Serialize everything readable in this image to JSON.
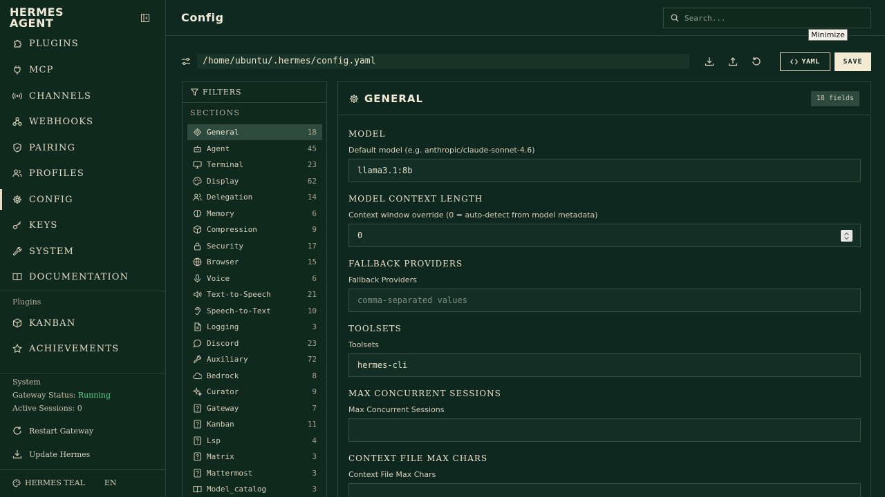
{
  "brand": {
    "line1": "HERMES",
    "line2": "AGENT"
  },
  "nav": [
    {
      "id": "plugins",
      "label": "PLUGINS",
      "icon": "puzzle-icon"
    },
    {
      "id": "mcp",
      "label": "MCP",
      "icon": "plug-icon"
    },
    {
      "id": "channels",
      "label": "CHANNELS",
      "icon": "broadcast-icon"
    },
    {
      "id": "webhooks",
      "label": "WEBHOOKS",
      "icon": "webhook-icon"
    },
    {
      "id": "pairing",
      "label": "PAIRING",
      "icon": "shield-icon"
    },
    {
      "id": "profiles",
      "label": "PROFILES",
      "icon": "users-icon"
    },
    {
      "id": "config",
      "label": "CONFIG",
      "icon": "gear-icon",
      "active": true
    },
    {
      "id": "keys",
      "label": "KEYS",
      "icon": "key-icon"
    },
    {
      "id": "system",
      "label": "SYSTEM",
      "icon": "wrench-icon"
    },
    {
      "id": "documentation",
      "label": "DOCUMENTATION",
      "icon": "book-icon"
    }
  ],
  "plugins_section": {
    "label": "Plugins",
    "items": [
      {
        "id": "kanban",
        "label": "KANBAN",
        "icon": "cube-icon"
      },
      {
        "id": "achievements",
        "label": "ACHIEVEMENTS",
        "icon": "star-icon"
      }
    ]
  },
  "system_status": {
    "label": "System",
    "gateway_label": "Gateway Status:",
    "gateway_value": "Running",
    "sessions_label": "Active Sessions:",
    "sessions_value": "0"
  },
  "actions": {
    "restart": "Restart Gateway",
    "update": "Update Hermes"
  },
  "footer": {
    "theme": "HERMES TEAL",
    "lang": "EN"
  },
  "header": {
    "title": "Config",
    "search_placeholder": "Search..."
  },
  "tooltip": "Minimize",
  "toolbar": {
    "path": "/home/ubuntu/.hermes/config.yaml",
    "yaml_label": "YAML",
    "save_label": "SAVE"
  },
  "filters": {
    "title": "FILTERS",
    "sections_label": "SECTIONS",
    "sections": [
      {
        "label": "General",
        "count": "18",
        "icon": "gear-icon",
        "active": true
      },
      {
        "label": "Agent",
        "count": "45",
        "icon": "robot-icon"
      },
      {
        "label": "Terminal",
        "count": "23",
        "icon": "monitor-icon"
      },
      {
        "label": "Display",
        "count": "62",
        "icon": "palette-icon"
      },
      {
        "label": "Delegation",
        "count": "14",
        "icon": "users-icon"
      },
      {
        "label": "Memory",
        "count": "6",
        "icon": "brain-icon"
      },
      {
        "label": "Compression",
        "count": "9",
        "icon": "package-icon"
      },
      {
        "label": "Security",
        "count": "17",
        "icon": "lock-icon"
      },
      {
        "label": "Browser",
        "count": "15",
        "icon": "globe-icon"
      },
      {
        "label": "Voice",
        "count": "6",
        "icon": "mic-icon"
      },
      {
        "label": "Text-to-Speech",
        "count": "21",
        "icon": "speaker-icon"
      },
      {
        "label": "Speech-to-Text",
        "count": "10",
        "icon": "ear-icon"
      },
      {
        "label": "Logging",
        "count": "3",
        "icon": "file-icon"
      },
      {
        "label": "Discord",
        "count": "23",
        "icon": "chat-icon"
      },
      {
        "label": "Auxiliary",
        "count": "72",
        "icon": "wrench-icon"
      },
      {
        "label": "Bedrock",
        "count": "8",
        "icon": "cloud-icon"
      },
      {
        "label": "Curator",
        "count": "9",
        "icon": "sparkle-icon"
      },
      {
        "label": "Gateway",
        "count": "7",
        "icon": "doc-question-icon"
      },
      {
        "label": "Kanban",
        "count": "11",
        "icon": "doc-question-icon"
      },
      {
        "label": "Lsp",
        "count": "4",
        "icon": "doc-question-icon"
      },
      {
        "label": "Matrix",
        "count": "3",
        "icon": "doc-question-icon"
      },
      {
        "label": "Mattermost",
        "count": "3",
        "icon": "doc-question-icon"
      },
      {
        "label": "Model_catalog",
        "count": "3",
        "icon": "book-icon"
      }
    ]
  },
  "general": {
    "title": "GENERAL",
    "field_count": "18 fields",
    "fields": [
      {
        "label": "MODEL",
        "desc": "Default model (e.g. anthropic/claude-sonnet-4.6)",
        "value": "llama3.1:8b",
        "placeholder": ""
      },
      {
        "label": "MODEL CONTEXT LENGTH",
        "desc": "Context window override (0 = auto-detect from model metadata)",
        "value": "0",
        "placeholder": ""
      },
      {
        "label": "FALLBACK PROVIDERS",
        "desc": "Fallback Providers",
        "value": "",
        "placeholder": "comma-separated values"
      },
      {
        "label": "TOOLSETS",
        "desc": "Toolsets",
        "value": "hermes-cli",
        "placeholder": ""
      },
      {
        "label": "MAX CONCURRENT SESSIONS",
        "desc": "Max Concurrent Sessions",
        "value": "",
        "placeholder": ""
      },
      {
        "label": "CONTEXT FILE MAX CHARS",
        "desc": "Context File Max Chars",
        "value": "",
        "placeholder": ""
      }
    ]
  },
  "colors": {
    "accent": "#f2ead3",
    "running": "#5fd08a",
    "background": "#0f2820"
  }
}
